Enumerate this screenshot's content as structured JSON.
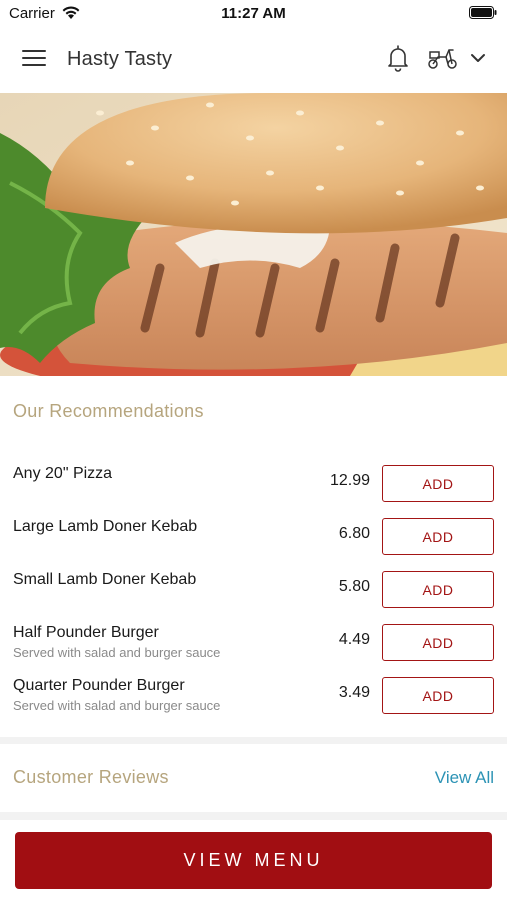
{
  "status_bar": {
    "carrier": "Carrier",
    "time": "11:27 AM"
  },
  "header": {
    "title": "Hasty Tasty",
    "icons": [
      "menu-icon",
      "bell-icon",
      "scooter-icon",
      "chevron-down-icon"
    ]
  },
  "hero": {
    "image": "grilled-chicken-burger-photo"
  },
  "recommendations": {
    "title": "Our Recommendations",
    "add_label": "ADD",
    "items": [
      {
        "name": "Any 20\" Pizza",
        "description": "",
        "price": "12.99"
      },
      {
        "name": "Large Lamb Doner Kebab",
        "description": "",
        "price": "6.80"
      },
      {
        "name": "Small Lamb Doner Kebab",
        "description": "",
        "price": "5.80"
      },
      {
        "name": "Half Pounder Burger",
        "description": "Served with salad and burger sauce",
        "price": "4.49"
      },
      {
        "name": "Quarter Pounder Burger",
        "description": "Served with salad and burger sauce",
        "price": "3.49"
      }
    ]
  },
  "reviews": {
    "title": "Customer Reviews",
    "view_all_label": "View All"
  },
  "footer": {
    "view_menu_label": "VIEW MENU"
  },
  "colors": {
    "accent": "#a10e12",
    "section_title": "#b6a57e",
    "link": "#2c93b5"
  }
}
